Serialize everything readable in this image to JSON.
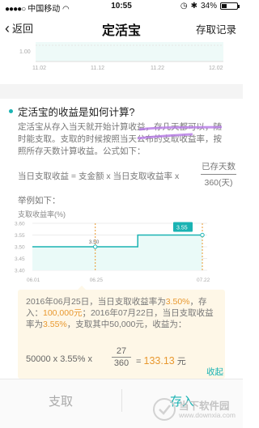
{
  "status_bar": {
    "carrier": "中国移动",
    "time": "10:55",
    "battery_percent": "34%",
    "battery_level": 0.34
  },
  "nav": {
    "back_label": "返回",
    "title": "定活宝",
    "right_label": "存取记录"
  },
  "top_chart": {
    "tick_label": "1.00",
    "dates": [
      "11.02",
      "11.12",
      "11.22",
      "12.02"
    ]
  },
  "section": {
    "title": "定活宝的收益是如何计算?",
    "paragraph": "定活宝从存入当天就开始计算收益，存几天都可以，随时能支取。支取的时候按照当天公布的支取收益率，按照所存天数计算收益。公式如下：",
    "formula_lhs": "当日支取收益 = 支金额 x 当日支取收益率 x",
    "formula_num": "已存天数",
    "formula_den": "360(天)",
    "example_label": "举例如下：",
    "chart_label": "支取收益率(%)"
  },
  "chart_data": {
    "type": "line",
    "ylabel": "支取收益率(%)",
    "yticks": [
      "3.60",
      "3.55",
      "3.50",
      "3.45",
      "3.40"
    ],
    "ylim": [
      3.4,
      3.6
    ],
    "xticks": [
      "06.01",
      "06.25",
      "07.22"
    ],
    "series": [
      {
        "x": [
          "06.01",
          "06.25",
          "07.07",
          "07.07",
          "07.22"
        ],
        "values": [
          3.5,
          3.5,
          3.5,
          3.55,
          3.55
        ]
      }
    ],
    "annotations": [
      {
        "x": "06.25",
        "y": 3.5,
        "label": "3.50"
      },
      {
        "x": "07.22",
        "y": 3.55,
        "label": "3.55"
      }
    ]
  },
  "example": {
    "line1_a": "2016年06月25日，当日支取收益率为",
    "line1_rate": "3.50%",
    "line1_b": "，存入：",
    "amount": "100,000元",
    "line2_a": "；2016年07月22日，当日支取收益率为",
    "line2_rate": "3.55%",
    "line2_b": "，支取其中50,000元，收益为：",
    "calc_part1": "50000 x 3.55% x",
    "calc_num": "27",
    "calc_den": "360",
    "calc_eq": "=",
    "calc_result": "133.13",
    "calc_unit": "元",
    "collapse_label": "收起"
  },
  "bottom_bar": {
    "withdraw_label": "支取",
    "deposit_label": "存入"
  },
  "watermark": {
    "name": "当下软件园",
    "url": "www.downxia.com"
  },
  "colors": {
    "accent": "#1ab3b3",
    "highlight_orange": "#e8982f",
    "box_bg": "#fef7e7"
  }
}
